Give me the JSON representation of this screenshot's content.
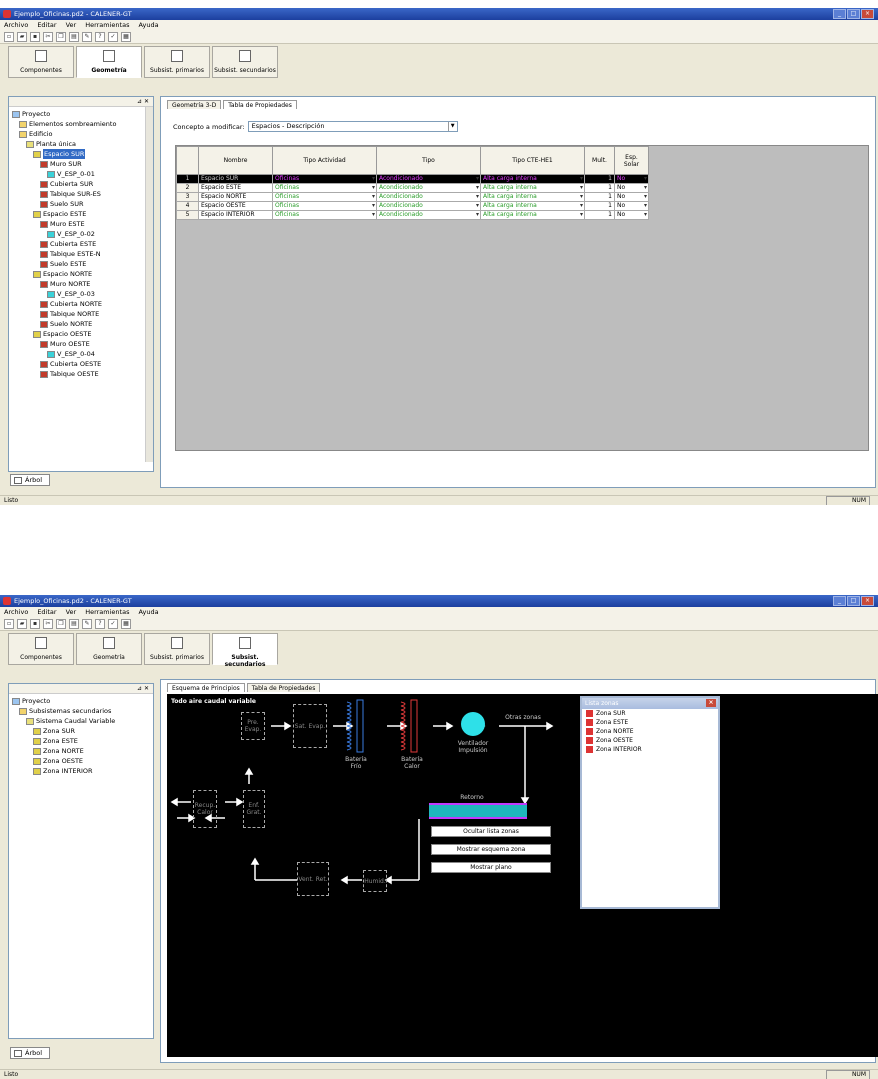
{
  "window1": {
    "title": "Ejemplo_Oficinas.pd2 - CALENER-GT",
    "menu": [
      "Archivo",
      "Editar",
      "Ver",
      "Herramientas",
      "Ayuda"
    ],
    "modules": [
      "Componentes",
      "Geometría",
      "Subsist. primarios",
      "Subsist. secundarios"
    ],
    "active_module": "Geometría",
    "tree_header": "",
    "tree": [
      {
        "label": "Proyecto",
        "level": 0
      },
      {
        "label": "Elementos sombreamiento",
        "level": 1
      },
      {
        "label": "Edificio",
        "level": 1
      },
      {
        "label": "Planta única",
        "level": 2
      },
      {
        "label": "Espacio SUR",
        "level": 3,
        "selected": true
      },
      {
        "label": "Muro SUR",
        "level": 4
      },
      {
        "label": "V_ESP_0-01",
        "level": 5
      },
      {
        "label": "Cubierta SUR",
        "level": 4
      },
      {
        "label": "Tabique SUR-ES",
        "level": 4
      },
      {
        "label": "Suelo SUR",
        "level": 4
      },
      {
        "label": "Espacio ESTE",
        "level": 3
      },
      {
        "label": "Muro ESTE",
        "level": 4
      },
      {
        "label": "V_ESP_0-02",
        "level": 5
      },
      {
        "label": "Cubierta ESTE",
        "level": 4
      },
      {
        "label": "Tabique ESTE-N",
        "level": 4
      },
      {
        "label": "Suelo ESTE",
        "level": 4
      },
      {
        "label": "Espacio NORTE",
        "level": 3
      },
      {
        "label": "Muro NORTE",
        "level": 4
      },
      {
        "label": "V_ESP_0-03",
        "level": 5
      },
      {
        "label": "Cubierta NORTE",
        "level": 4
      },
      {
        "label": "Tabique NORTE",
        "level": 4
      },
      {
        "label": "Suelo NORTE",
        "level": 4
      },
      {
        "label": "Espacio OESTE",
        "level": 3
      },
      {
        "label": "Muro OESTE",
        "level": 4
      },
      {
        "label": "V_ESP_0-04",
        "level": 5
      },
      {
        "label": "Cubierta OESTE",
        "level": 4
      },
      {
        "label": "Tabique OESTE",
        "level": 4
      }
    ],
    "bottom_tab": "Árbol",
    "subtabs": [
      "Geometría 3-D",
      "Tabla de Propiedades"
    ],
    "active_subtab": "Tabla de Propiedades",
    "concept_label": "Concepto a modificar:",
    "concept_value": "Espacios - Descripción",
    "columns": [
      "",
      "Nombre",
      "Tipo Actividad",
      "Tipo",
      "Tipo CTE-HE1",
      "Mult.",
      "Esp. Solar"
    ],
    "rows": [
      [
        "1",
        "Espacio SUR",
        "Oficinas",
        "Acondicionado",
        "Alta carga interna",
        "1",
        "No"
      ],
      [
        "2",
        "Espacio ESTE",
        "Oficinas",
        "Acondicionado",
        "Alta carga interna",
        "1",
        "No"
      ],
      [
        "3",
        "Espacio NORTE",
        "Oficinas",
        "Acondicionado",
        "Alta carga interna",
        "1",
        "No"
      ],
      [
        "4",
        "Espacio OESTE",
        "Oficinas",
        "Acondicionado",
        "Alta carga interna",
        "1",
        "No"
      ],
      [
        "5",
        "Espacio INTERIOR",
        "Oficinas",
        "Acondicionado",
        "Alta carga interna",
        "1",
        "No"
      ]
    ],
    "status": "Listo",
    "num": "NUM"
  },
  "window2": {
    "title": "Ejemplo_Oficinas.pd2 - CALENER-GT",
    "menu": [
      "Archivo",
      "Editar",
      "Ver",
      "Herramientas",
      "Ayuda"
    ],
    "modules": [
      "Componentes",
      "Geometría",
      "Subsist. primarios",
      "Subsist. secundarios"
    ],
    "active_module": "Subsist. secundarios",
    "tree": [
      {
        "label": "Proyecto",
        "level": 0
      },
      {
        "label": "Subsistemas secundarios",
        "level": 1
      },
      {
        "label": "Sistema Caudal Variable",
        "level": 2
      },
      {
        "label": "Zona SUR",
        "level": 3
      },
      {
        "label": "Zona ESTE",
        "level": 3
      },
      {
        "label": "Zona NORTE",
        "level": 3
      },
      {
        "label": "Zona OESTE",
        "level": 3
      },
      {
        "label": "Zona INTERIOR",
        "level": 3
      }
    ],
    "bottom_tab": "Árbol",
    "subtabs": [
      "Esquema de Principios",
      "Tabla de Propiedades"
    ],
    "active_subtab": "Esquema de Principios",
    "diagram": {
      "title": "Todo aire caudal variable",
      "pre_evap": "Pre. Evap.",
      "sat_evap": "Sat. Evap.",
      "bat_frio": "Batería Frío",
      "bat_calor": "Batería Calor",
      "ventilador": "Ventilador Impulsión",
      "otras_zonas": "Otras zonas",
      "retorno": "Retorno",
      "recup": "Recup. Calor",
      "enf": "Enf. Grat.",
      "vent_ret": "Vent. Ret.",
      "humid": "Humid."
    },
    "buttons": [
      "Ocultar lista zonas",
      "Mostrar esquema zona",
      "Mostrar plano"
    ],
    "zone_list_title": "Lista zonas",
    "zones": [
      "Zona SUR",
      "Zona ESTE",
      "Zona NORTE",
      "Zona OESTE",
      "Zona INTERIOR"
    ],
    "status": "Listo",
    "num": "NUM"
  }
}
